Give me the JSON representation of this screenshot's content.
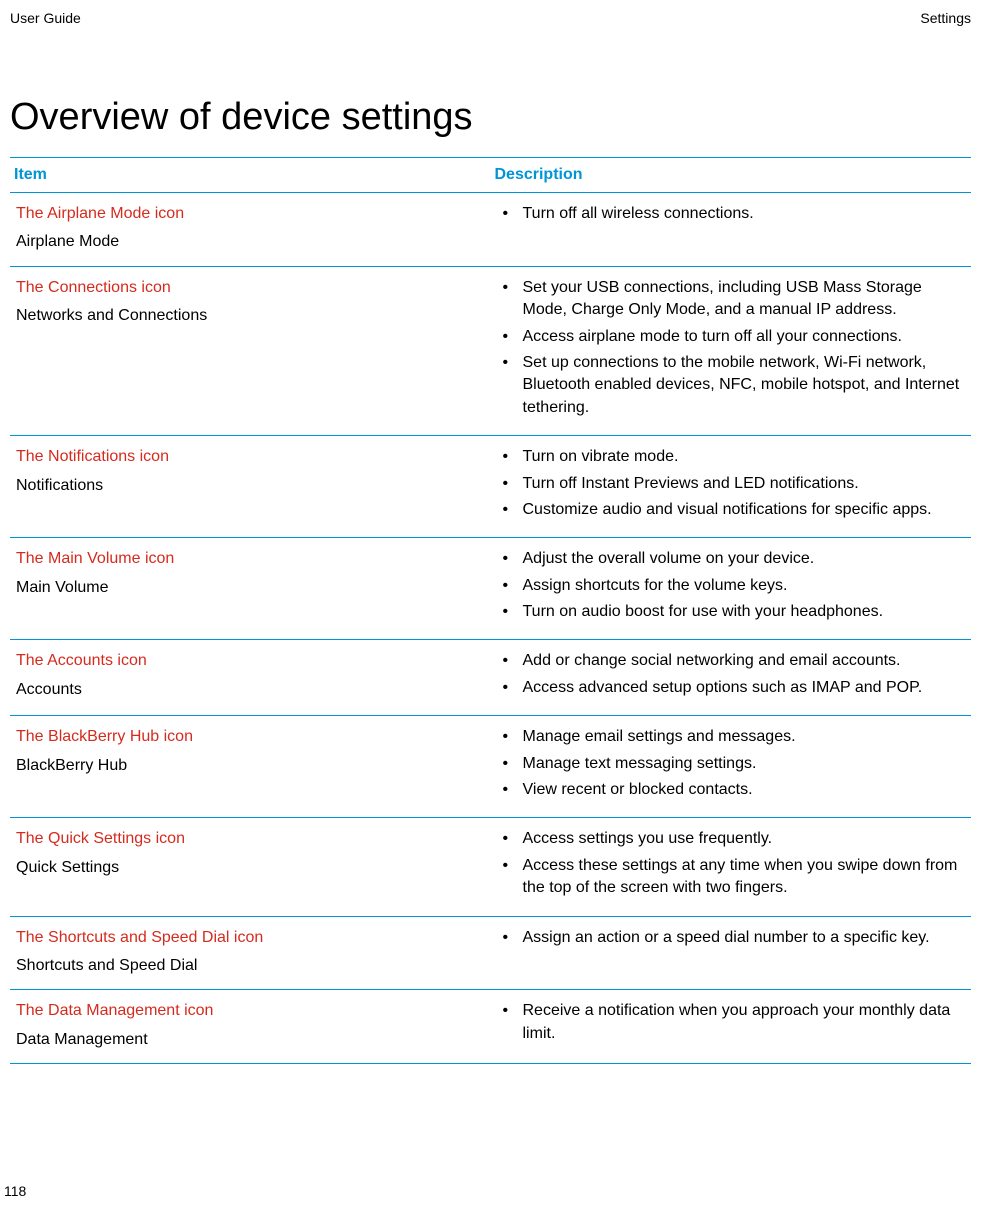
{
  "header": {
    "left": "User Guide",
    "right": "Settings"
  },
  "title": "Overview of device settings",
  "table": {
    "headers": {
      "item": "Item",
      "description": "Description"
    },
    "rows": [
      {
        "icon": "The Airplane Mode icon",
        "name": "Airplane Mode",
        "desc": [
          "Turn off all wireless connections."
        ]
      },
      {
        "icon": "The Connections icon",
        "name": "Networks and Connections",
        "desc": [
          "Set your USB connections, including USB Mass Storage Mode, Charge Only Mode, and a manual IP address.",
          "Access airplane mode to turn off all your connections.",
          "Set up connections to the mobile network, Wi-Fi network, Bluetooth enabled devices, NFC, mobile hotspot, and Internet tethering."
        ]
      },
      {
        "icon": "The Notifications icon",
        "name": "Notifications",
        "desc": [
          "Turn on vibrate mode.",
          "Turn off Instant Previews and LED notifications.",
          "Customize audio and visual notifications for specific apps."
        ]
      },
      {
        "icon": "The Main Volume icon",
        "name": "Main Volume",
        "desc": [
          "Adjust the overall volume on your device.",
          "Assign shortcuts for the volume keys.",
          "Turn on audio boost for use with your headphones."
        ]
      },
      {
        "icon": "The Accounts icon",
        "name": "Accounts",
        "desc": [
          "Add or change social networking and email accounts.",
          "Access advanced setup options such as IMAP and POP."
        ]
      },
      {
        "icon": "The BlackBerry Hub icon",
        "name": "BlackBerry Hub",
        "desc": [
          "Manage email settings and messages.",
          "Manage text messaging settings.",
          "View recent or blocked contacts."
        ]
      },
      {
        "icon": "The Quick Settings icon",
        "name": "Quick Settings",
        "desc": [
          "Access settings you use frequently.",
          "Access these settings at any time when you swipe down from the top of the screen with two fingers."
        ]
      },
      {
        "icon": "The Shortcuts and Speed Dial icon",
        "name": "Shortcuts and Speed Dial",
        "desc": [
          "Assign an action or a speed dial number to a specific key."
        ]
      },
      {
        "icon": "The Data Management icon",
        "name": "Data Management",
        "desc": [
          "Receive a notification when you approach your monthly data limit."
        ]
      }
    ]
  },
  "pageNumber": "118"
}
